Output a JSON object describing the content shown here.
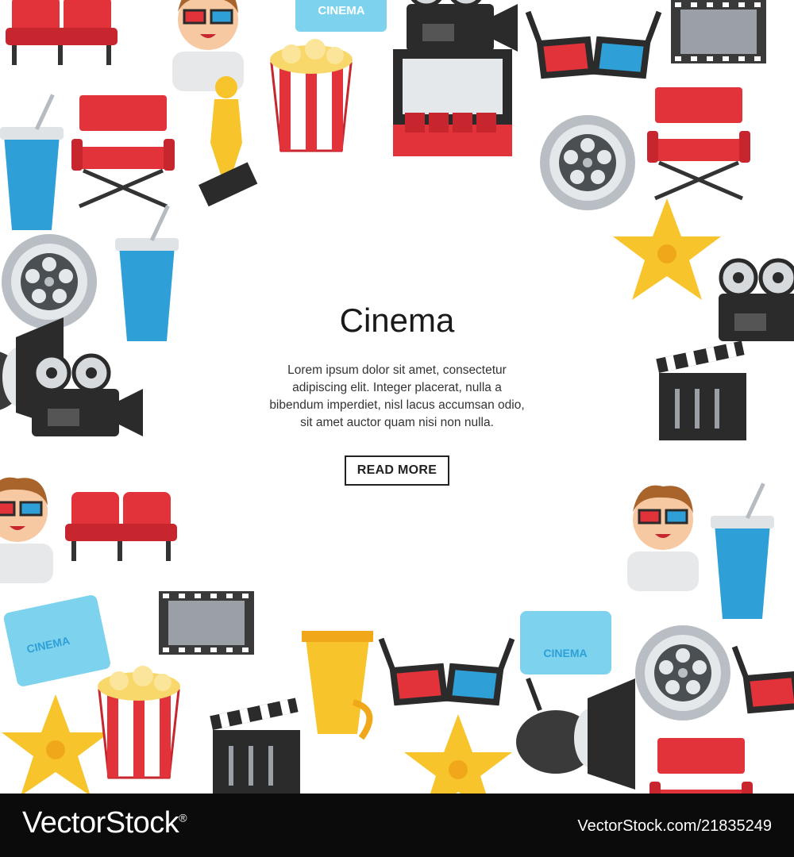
{
  "hero": {
    "title": "Cinema",
    "body_lines": [
      "Lorem ipsum dolor sit amet, consectetur",
      "adipiscing elit. Integer placerat, nulla a",
      "bibendum imperdiet, nisl lacus accumsan odio,",
      "sit amet auctor quam nisi non nulla."
    ],
    "button_label": "READ MORE"
  },
  "tickets": {
    "text": "CINEMA"
  },
  "footer": {
    "brand": "VectorStock",
    "registered": "®",
    "image_id": "VectorStock.com/21835249"
  },
  "colors": {
    "red": "#e2333b",
    "blue": "#2f9fd8",
    "light_blue": "#7dd3ee",
    "gold": "#f7c52b",
    "gray": "#9aa0a6",
    "dark": "#2b2b2b",
    "footer_bg": "#0b0b0b"
  }
}
